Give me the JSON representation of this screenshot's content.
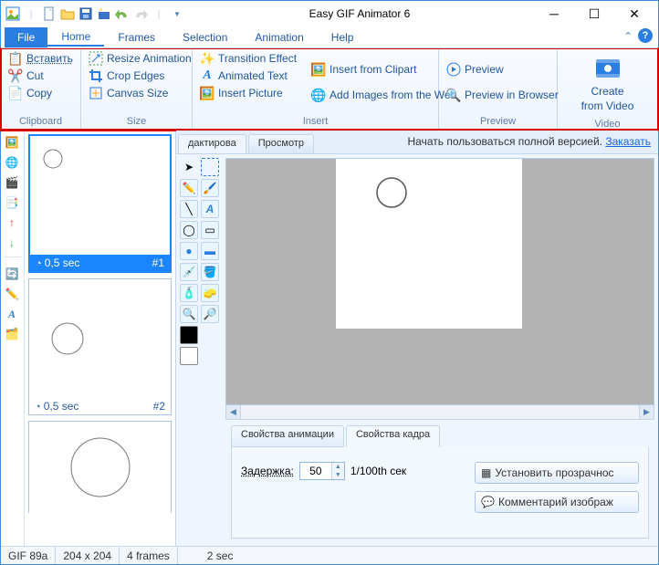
{
  "title": "Easy GIF Animator 6",
  "menu": {
    "file": "File",
    "tabs": [
      "Home",
      "Frames",
      "Selection",
      "Animation",
      "Help"
    ]
  },
  "ribbon": {
    "clipboard": {
      "label": "Clipboard",
      "paste": "Вставить",
      "cut": "Cut",
      "copy": "Copy"
    },
    "size": {
      "label": "Size",
      "resize": "Resize Animation",
      "crop": "Crop Edges",
      "canvas": "Canvas Size"
    },
    "effects": {
      "transition": "Transition Effect",
      "animtext": "Animated Text",
      "insertpic": "Insert Picture"
    },
    "insert": {
      "label": "Insert",
      "clipart": "Insert from Clipart",
      "web": "Add Images from the Web"
    },
    "preview": {
      "label": "Preview",
      "preview": "Preview",
      "browser": "Preview in Browser"
    },
    "video": {
      "label": "Video",
      "line1": "Create",
      "line2": "from Video"
    }
  },
  "viewTabs": {
    "edit": "дактирова",
    "view": "Просмотр"
  },
  "promo": {
    "text": "Начать пользоваться полной версией. ",
    "link": "Заказать"
  },
  "frames": [
    {
      "duration": "0,5 sec",
      "index": "#1"
    },
    {
      "duration": "0,5 sec",
      "index": "#2"
    }
  ],
  "props": {
    "tabAnim": "Свойства анимации",
    "tabFrame": "Свойства кадра",
    "delayLabel": "Задержка:",
    "delayVal": "50",
    "delayUnit": "1/100th сек",
    "transpBtn": "Установить прозрачнос",
    "commentBtn": "Комментарий изображ"
  },
  "status": {
    "fmt": "GIF 89a",
    "dim": "204 x 204",
    "frames": "4 frames",
    "dur": "2 sec"
  }
}
